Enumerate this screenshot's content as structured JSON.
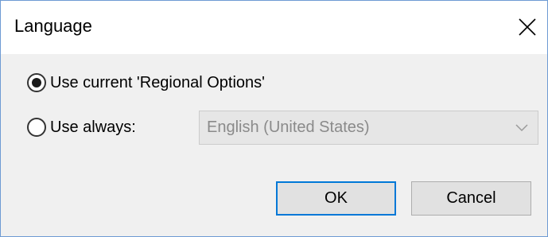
{
  "window": {
    "title": "Language",
    "close_icon": "close-icon"
  },
  "options": {
    "regional": {
      "label": "Use current 'Regional Options'",
      "selected": true
    },
    "always": {
      "label": "Use always:",
      "selected": false
    }
  },
  "language_select": {
    "value": "English (United States)",
    "enabled": false,
    "icon": "chevron-down-icon"
  },
  "buttons": {
    "ok": "OK",
    "cancel": "Cancel"
  },
  "colors": {
    "accent": "#0078d7",
    "window_border": "#6e9bd3",
    "dialog_bg": "#f0f0f0",
    "disabled_text": "#8a8a8a"
  }
}
